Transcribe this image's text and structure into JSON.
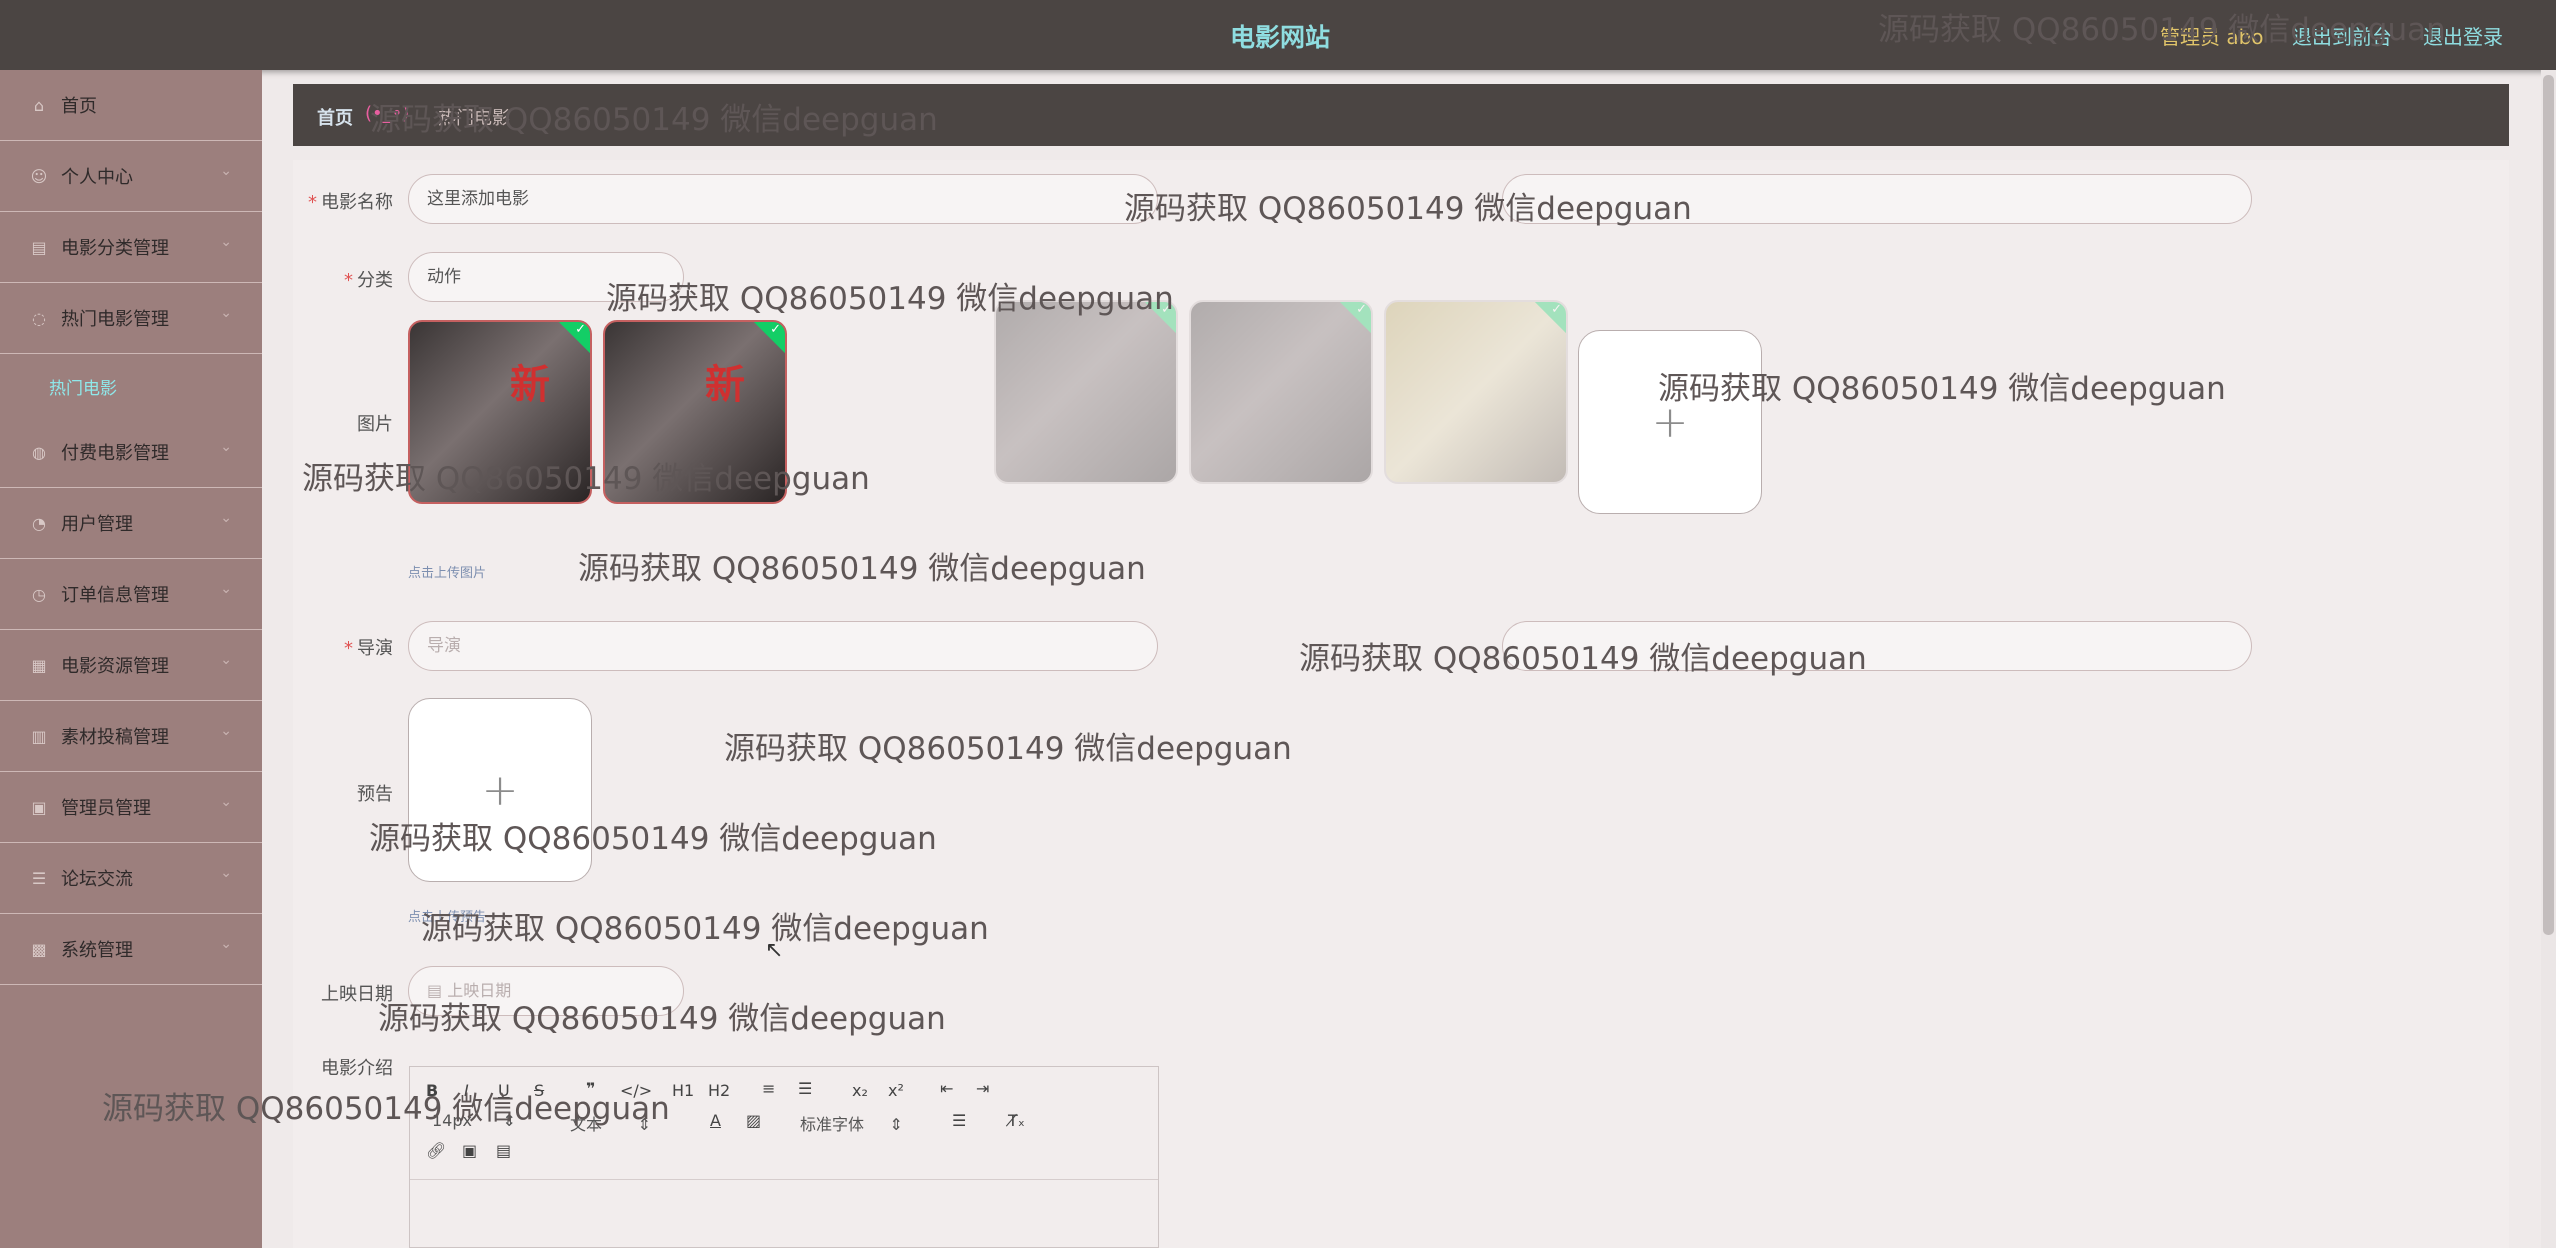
{
  "header": {
    "site_title": "电影网站",
    "user_role": "管理员 abo",
    "link_frontend": "退出到前台",
    "link_logout": "退出登录"
  },
  "sidebar": {
    "items": [
      {
        "label": "首页",
        "icon": "home-icon"
      },
      {
        "label": "个人中心",
        "icon": "user-icon"
      },
      {
        "label": "电影分类管理",
        "icon": "list-icon"
      },
      {
        "label": "热门电影管理",
        "icon": "fire-icon"
      },
      {
        "label": "付费电影管理",
        "icon": "pay-icon"
      },
      {
        "label": "用户管理",
        "icon": "users-icon"
      },
      {
        "label": "订单信息管理",
        "icon": "order-icon"
      },
      {
        "label": "电影资源管理",
        "icon": "film-icon"
      },
      {
        "label": "素材投稿管理",
        "icon": "upload-icon"
      },
      {
        "label": "管理员管理",
        "icon": "admin-icon"
      },
      {
        "label": "论坛交流",
        "icon": "forum-icon"
      },
      {
        "label": "系统管理",
        "icon": "settings-icon"
      }
    ],
    "sub_active": "热门电影"
  },
  "breadcrumb": {
    "home": "首页",
    "separator": "(•_•)",
    "current": "热门电影"
  },
  "form": {
    "name_label": "电影名称",
    "name_value": "这里添加电影",
    "category_label": "分类",
    "category_value": "动作",
    "image_label": "图片",
    "image_tip": "点击上传图片",
    "director_label": "导演",
    "director_placeholder": "导演",
    "trailer_label": "预告",
    "trailer_tip": "点击上传预告",
    "release_label": "上映日期",
    "release_placeholder": "上映日期",
    "intro_label": "电影介绍"
  },
  "editor": {
    "font_size": "14px",
    "text_style": "文本",
    "font_family": "标准字体",
    "h1": "H1",
    "h2": "H2"
  },
  "watermark": "源码获取 QQ86050149 微信deepguan",
  "colors": {
    "topbar": "#4b4543",
    "sidebar": "#9c7f7d",
    "accent": "#8fdde0",
    "required": "#e05252",
    "success": "#13ce66"
  }
}
